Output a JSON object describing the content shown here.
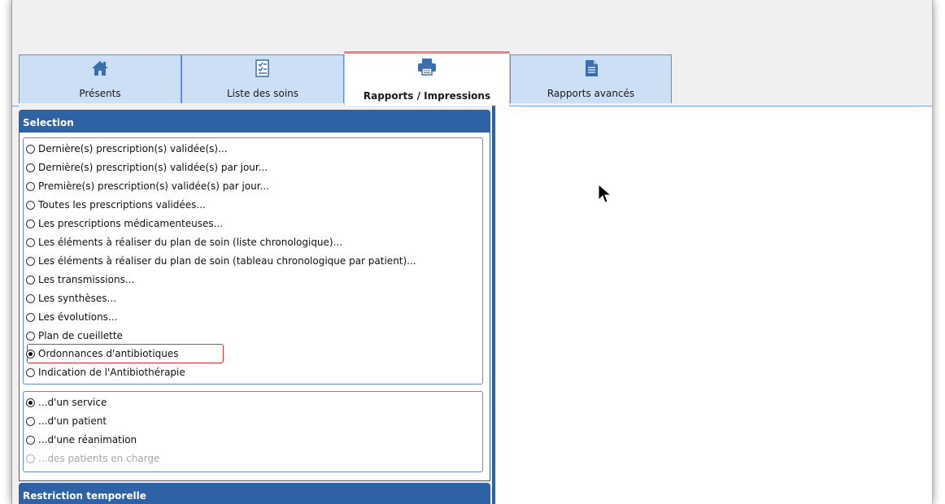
{
  "tabs": [
    {
      "label": "Présents",
      "icon": "home-icon"
    },
    {
      "label": "Liste des soins",
      "icon": "checklist-icon"
    },
    {
      "label": "Rapports / Impressions",
      "icon": "printer-icon",
      "active": true
    },
    {
      "label": "Rapports avancés",
      "icon": "document-icon"
    }
  ],
  "selection": {
    "header": "Selection",
    "report_options": [
      {
        "label": "Dernière(s) prescription(s) validée(s)...",
        "selected": false
      },
      {
        "label": "Dernière(s) prescription(s) validée(s) par jour...",
        "selected": false
      },
      {
        "label": "Première(s) prescription(s) validée(s) par jour...",
        "selected": false
      },
      {
        "label": "Toutes les prescriptions validées...",
        "selected": false
      },
      {
        "label": "Les prescriptions médicamenteuses...",
        "selected": false
      },
      {
        "label": "Les éléments à réaliser du plan de soin (liste chronologique)...",
        "selected": false
      },
      {
        "label": "Les éléments à réaliser du plan de soin (tableau chronologique par patient)...",
        "selected": false
      },
      {
        "label": "Les transmissions...",
        "selected": false
      },
      {
        "label": "Les synthèses...",
        "selected": false
      },
      {
        "label": "Les évolutions...",
        "selected": false
      },
      {
        "label": "Plan de cueillette",
        "selected": false
      },
      {
        "label": "Ordonnances d'antibiotiques",
        "selected": true
      },
      {
        "label": "Indication de l'Antibiothérapie",
        "selected": false
      }
    ],
    "scope_options": [
      {
        "label": "...d'un service",
        "selected": true,
        "enabled": true
      },
      {
        "label": "...d'un patient",
        "selected": false,
        "enabled": true
      },
      {
        "label": "...d'une réanimation",
        "selected": false,
        "enabled": true
      },
      {
        "label": "...des patients en charge",
        "selected": false,
        "enabled": false
      }
    ]
  },
  "restriction": {
    "header": "Restriction temporelle"
  },
  "colors": {
    "header_blue": "#2f62a5",
    "tab_blue": "#cddff4",
    "highlight_red": "#e0303a"
  }
}
